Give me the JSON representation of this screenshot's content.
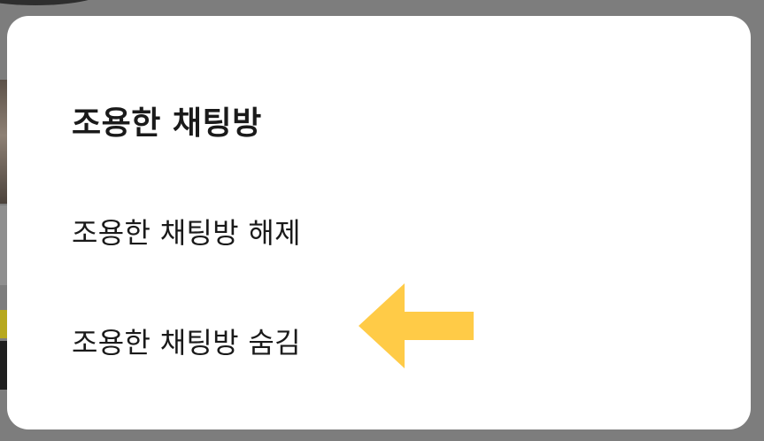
{
  "dialog": {
    "title": "조용한 채팅방",
    "menu": [
      {
        "label": "조용한 채팅방 해제"
      },
      {
        "label": "조용한 채팅방 숨김"
      }
    ]
  },
  "annotation": {
    "arrow_icon": "left-arrow-icon",
    "arrow_color": "#ffcb47"
  },
  "colors": {
    "overlay": "#7d7d7d",
    "dialog_background": "#ffffff",
    "text": "#1a1a1a"
  }
}
